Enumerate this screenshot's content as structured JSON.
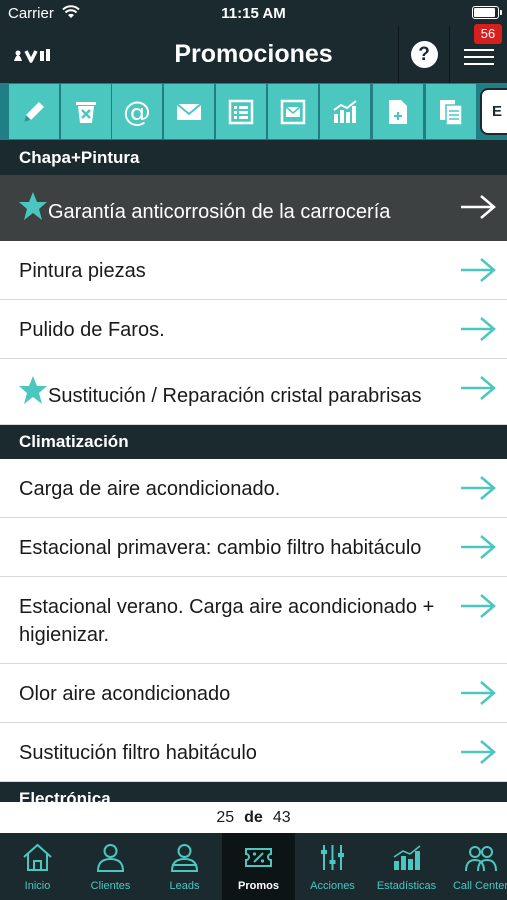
{
  "status_bar": {
    "carrier": "Carrier",
    "time": "11:15 AM",
    "battery_level": 0.95
  },
  "navbar": {
    "title": "Promociones",
    "help_label": "?",
    "badge_count": "56"
  },
  "toolbar": {
    "icons": [
      "pencil-icon",
      "trash-icon",
      "at-sign-icon",
      "envelope-icon",
      "list-icon",
      "mail-icon",
      "bar-chart-icon",
      "new-document-icon",
      "copy-document-icon"
    ],
    "last_tab_label": "E"
  },
  "sections": [
    {
      "title": "Chapa+Pintura",
      "items": [
        {
          "label": "Garantía anticorrosión de la carrocería",
          "starred": true,
          "selected": true
        },
        {
          "label": "Pintura piezas",
          "starred": false,
          "selected": false
        },
        {
          "label": "Pulido de Faros.",
          "starred": false,
          "selected": false
        },
        {
          "label": "Sustitución / Reparación cristal parabrisas",
          "starred": true,
          "selected": false
        }
      ]
    },
    {
      "title": "Climatización",
      "items": [
        {
          "label": "Carga de aire acondicionado.",
          "starred": false,
          "selected": false
        },
        {
          "label": "Estacional primavera: cambio filtro habitáculo",
          "starred": false,
          "selected": false
        },
        {
          "label": "Estacional verano. Carga aire acondicionado + higienizar.",
          "starred": false,
          "selected": false
        },
        {
          "label": "Olor aire acondicionado",
          "starred": false,
          "selected": false
        },
        {
          "label": "Sustitución filtro habitáculo",
          "starred": false,
          "selected": false
        }
      ]
    },
    {
      "title": "Electrónica",
      "items": []
    }
  ],
  "pager": {
    "current": "25",
    "separator": "de",
    "total": "43"
  },
  "tabs": [
    {
      "label": "Inicio",
      "icon": "home-icon",
      "active": false
    },
    {
      "label": "Clientes",
      "icon": "user-icon",
      "active": false
    },
    {
      "label": "Leads",
      "icon": "lead-user-icon",
      "active": false
    },
    {
      "label": "Promos",
      "icon": "discount-tag-icon",
      "active": true
    },
    {
      "label": "Acciones",
      "icon": "sliders-icon",
      "active": false
    },
    {
      "label": "Estadísticas",
      "icon": "statistics-icon",
      "active": false
    },
    {
      "label": "Call Center",
      "icon": "call-center-icon",
      "active": false
    }
  ],
  "colors": {
    "dark": "#1b2a2f",
    "accent": "#4bc7c0",
    "toolbar_bg": "#1f7f84",
    "selected_row": "#3d4142",
    "badge": "#d61f1f"
  }
}
